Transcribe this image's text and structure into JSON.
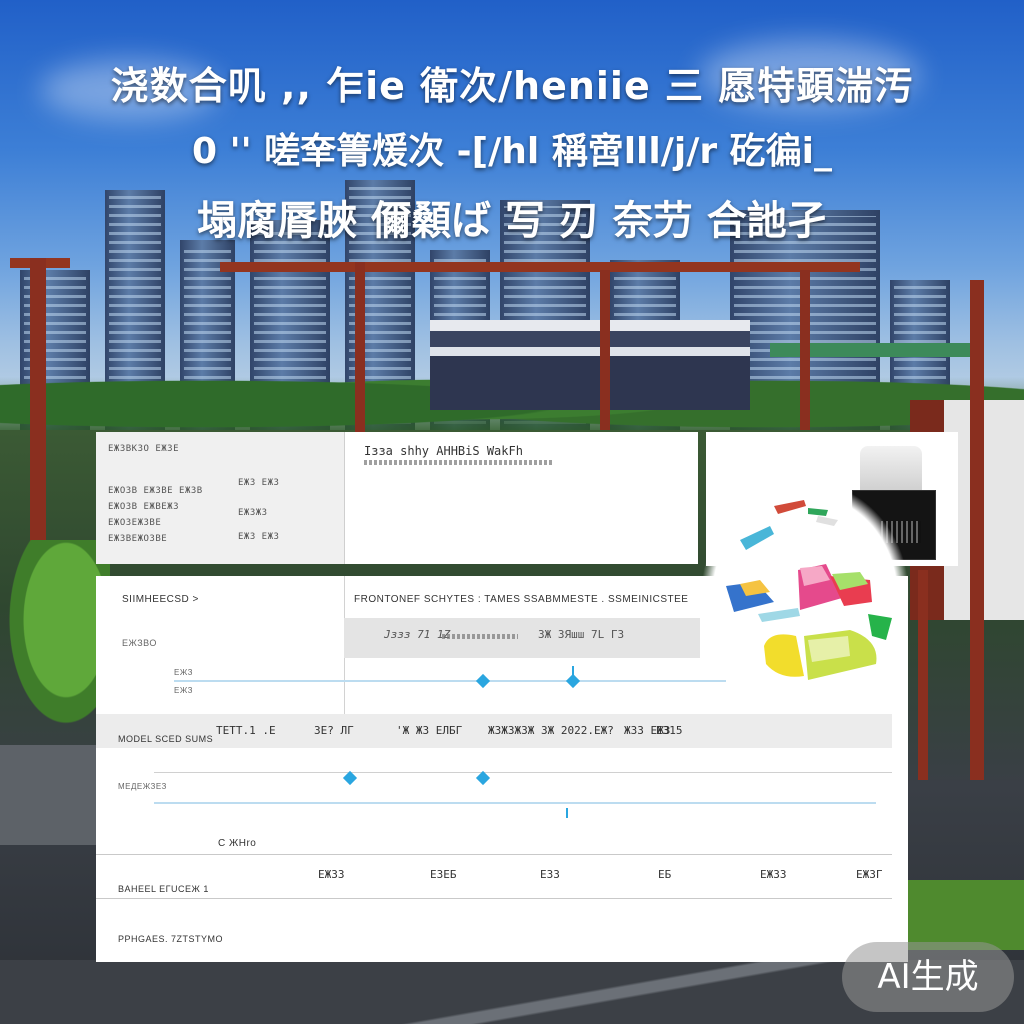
{
  "headline": {
    "line1": "浇数合叽 ,, 乍ie 衛次/heniie 三 愿特顕湍汚",
    "line2": "0 '' 嗟羍箐煖次 -[/hl 稱啻lll/j/r 矻徧i_",
    "line3": "塌腐脣脥 儞顙ば 写 刃 奈芀 合訑孑"
  },
  "top_panel": {
    "left_title": "ЕЖЗВКЗО ЕЖЗЕ",
    "right_title": "Iзза shhy AHHBiS WakFh",
    "left_rows": [
      "ЕЖОЗВ ЕЖЗВЕ ЕЖЗВ",
      "ЕЖОЗВ ЕЖВЕЖЗ",
      "ЕЖОЗЕЖЗВЕ",
      "ЕЖЗВЕЖОЗВЕ"
    ],
    "right_rows": [
      "ЕЖЗ ЕЖЗ",
      "ЕЖЗЖЗ",
      "ЕЖЗ ЕЖЗ"
    ]
  },
  "main_panel": {
    "left_title": "SIIMHEECSD >",
    "left_sub": "ЕЖЗВО",
    "header": "FRONTONEF SCHYTES : TAMES SSABMMESTE . SSMEINICSTEE",
    "band1": {
      "left": "Jззз 71 1Z",
      "right": "ЗЖ ЗЯшш 7L ГЗ"
    },
    "row_label_a": "ЕЖЗ",
    "row_label_b": "ЕЖЗ",
    "band2": {
      "label": "MODEL SCED SUMS",
      "cells": [
        "TЕТТ.1 .Е",
        "ЗЕ? ЛГ",
        "'Ж ЖЗ ЕЛБГ",
        "ЖЗЖЗЖЗЖ ЗЖ  2022.ЕЖ?",
        "ЖЗЗ ЕЖЗ",
        "ЕЗ15"
      ]
    },
    "mid_label": "МЕДЕЖЗЕЗ",
    "cell_label": "C ЖНro",
    "stat_values": [
      "ЕЖ3З",
      "ЕЗЕБ",
      "ЕЗЗ",
      "ЕБ",
      "ЕЖЗЗ",
      "ЕЖЗГ"
    ],
    "footer1": "BAНЕEL ЕГUCЕЖ 1",
    "footer2": "PPHGAES. 7ZTSTYMO"
  },
  "ai_badge": "AI生成",
  "colors": {
    "accent": "#2aa6e0",
    "sky": "#2160c8",
    "beam": "#93351f"
  }
}
